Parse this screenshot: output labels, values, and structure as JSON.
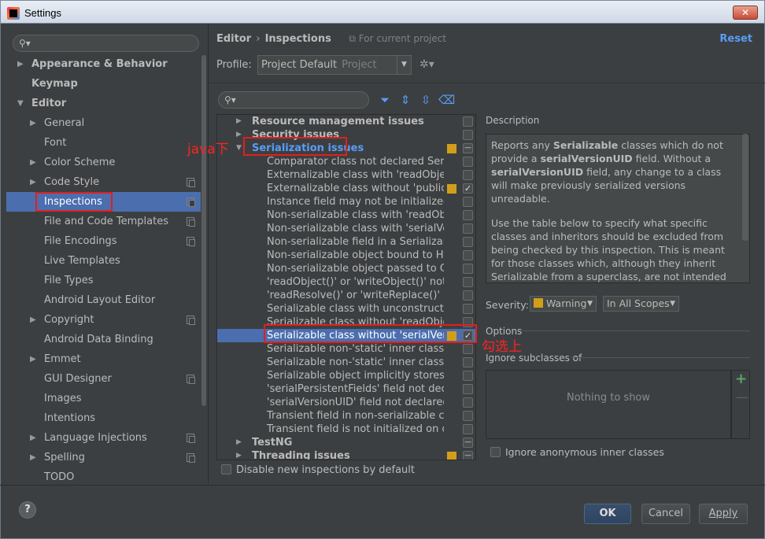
{
  "window": {
    "title": "Settings",
    "close_label": "✕"
  },
  "sidebar": {
    "search_placeholder": "",
    "items": [
      {
        "label": "Appearance & Behavior",
        "level": 0,
        "arrow": "▶",
        "bold": true
      },
      {
        "label": "Keymap",
        "level": 0,
        "arrow": "",
        "bold": true
      },
      {
        "label": "Editor",
        "level": 0,
        "arrow": "▼",
        "bold": true
      },
      {
        "label": "General",
        "level": 1,
        "arrow": "▶"
      },
      {
        "label": "Font",
        "level": 1,
        "arrow": ""
      },
      {
        "label": "Color Scheme",
        "level": 1,
        "arrow": "▶"
      },
      {
        "label": "Code Style",
        "level": 1,
        "arrow": "▶",
        "copy": true
      },
      {
        "label": "Inspections",
        "level": 1,
        "arrow": "",
        "copy": true,
        "selected": true
      },
      {
        "label": "File and Code Templates",
        "level": 1,
        "arrow": "",
        "copy": true
      },
      {
        "label": "File Encodings",
        "level": 1,
        "arrow": "",
        "copy": true
      },
      {
        "label": "Live Templates",
        "level": 1,
        "arrow": ""
      },
      {
        "label": "File Types",
        "level": 1,
        "arrow": ""
      },
      {
        "label": "Android Layout Editor",
        "level": 1,
        "arrow": ""
      },
      {
        "label": "Copyright",
        "level": 1,
        "arrow": "▶",
        "copy": true
      },
      {
        "label": "Android Data Binding",
        "level": 1,
        "arrow": ""
      },
      {
        "label": "Emmet",
        "level": 1,
        "arrow": "▶"
      },
      {
        "label": "GUI Designer",
        "level": 1,
        "arrow": "",
        "copy": true
      },
      {
        "label": "Images",
        "level": 1,
        "arrow": ""
      },
      {
        "label": "Intentions",
        "level": 1,
        "arrow": ""
      },
      {
        "label": "Language Injections",
        "level": 1,
        "arrow": "▶",
        "copy": true
      },
      {
        "label": "Spelling",
        "level": 1,
        "arrow": "▶",
        "copy": true
      },
      {
        "label": "TODO",
        "level": 1,
        "arrow": ""
      }
    ]
  },
  "header": {
    "crumb_editor": "Editor",
    "crumb_sep": "›",
    "crumb_inspections": "Inspections",
    "scope_note": "For current project",
    "reset": "Reset"
  },
  "profile": {
    "label": "Profile:",
    "value": "Project Default",
    "sub": "Project"
  },
  "inspections": [
    {
      "label": "Resource management issues",
      "type": "group",
      "arrow": "▶",
      "cb": "empty"
    },
    {
      "label": "Security issues",
      "type": "group",
      "arrow": "▶",
      "cb": "empty"
    },
    {
      "label": "Serialization issues",
      "type": "group",
      "arrow": "▼",
      "cb": "dash",
      "sev": true,
      "link": true
    },
    {
      "label": "Comparator class not declared Serializable",
      "type": "child",
      "cb": "empty"
    },
    {
      "label": "Externalizable class with 'readObject()' or 'writeObject()'",
      "type": "child",
      "cb": "empty"
    },
    {
      "label": "Externalizable class without 'public' no-arg constructor",
      "type": "child",
      "cb": "checked",
      "sev": true
    },
    {
      "label": "Instance field may not be initialized by readObject()",
      "type": "child",
      "cb": "empty"
    },
    {
      "label": "Non-serializable class with 'readObject()' or 'writeObject()'",
      "type": "child",
      "cb": "empty"
    },
    {
      "label": "Non-serializable class with 'serialVersionUID'",
      "type": "child",
      "cb": "empty"
    },
    {
      "label": "Non-serializable field in a Serializable class",
      "type": "child",
      "cb": "empty"
    },
    {
      "label": "Non-serializable object bound to HttpSession",
      "type": "child",
      "cb": "empty"
    },
    {
      "label": "Non-serializable object passed to ObjectOutputStream",
      "type": "child",
      "cb": "empty"
    },
    {
      "label": "'readObject()' or 'writeObject()' not declared 'private'",
      "type": "child",
      "cb": "empty"
    },
    {
      "label": "'readResolve()' or 'writeReplace()' not declared 'protected'",
      "type": "child",
      "cb": "empty"
    },
    {
      "label": "Serializable class with unconstructable ancestor",
      "type": "child",
      "cb": "empty"
    },
    {
      "label": "Serializable class without 'readObject()' and 'writeObject()'",
      "type": "child",
      "cb": "empty"
    },
    {
      "label": "Serializable class without 'serialVersionUID'",
      "type": "child",
      "cb": "checked",
      "sev": true,
      "selected": true
    },
    {
      "label": "Serializable non-'static' inner class with non-Serializable outer class",
      "type": "child",
      "cb": "empty"
    },
    {
      "label": "Serializable non-'static' inner class without 'serialVersionUID'",
      "type": "child",
      "cb": "empty"
    },
    {
      "label": "Serializable object implicitly stores non-Serializable object",
      "type": "child",
      "cb": "empty"
    },
    {
      "label": "'serialPersistentFields' field not declared 'private static final'",
      "type": "child",
      "cb": "empty"
    },
    {
      "label": "'serialVersionUID' field not declared 'private static final long'",
      "type": "child",
      "cb": "empty"
    },
    {
      "label": "Transient field in non-serializable class",
      "type": "child",
      "cb": "empty"
    },
    {
      "label": "Transient field is not initialized on deserialization",
      "type": "child",
      "cb": "empty"
    },
    {
      "label": "TestNG",
      "type": "group",
      "arrow": "▶",
      "cb": "dash"
    },
    {
      "label": "Threading issues",
      "type": "group",
      "arrow": "▶",
      "cb": "dash",
      "sev": true
    }
  ],
  "annotations": {
    "java_label": "java下",
    "check_label": "勾选上"
  },
  "disable_new": "Disable new inspections by default",
  "description": {
    "title": "Description",
    "p1_a": "Reports any ",
    "p1_b": "Serializable",
    "p1_c": " classes which do not provide a ",
    "p1_d": "serialVersionUID",
    "p1_e": " field. Without a ",
    "p1_f": "serialVersionUID",
    "p1_g": " field, any change to a class will make previously serialized versions unreadable.",
    "p2": "Use the table below to specify what specific classes and inheritors should be excluded from being checked by this inspection. This is meant for those classes which, although they inherit Serializable from a superclass, are not intended for serialization. Such classes would lead this inspection to report"
  },
  "severity": {
    "label": "Severity:",
    "value": "Warning",
    "scope": "In All Scopes"
  },
  "options": {
    "title": "Options",
    "ignore_subclasses": "Ignore subclasses of",
    "empty_list": "Nothing to show",
    "ignore_anonymous": "Ignore anonymous inner classes"
  },
  "footer": {
    "help": "?",
    "ok": "OK",
    "cancel": "Cancel",
    "apply": "Apply"
  },
  "colors": {
    "accent": "#4b6eaf",
    "warning": "#d29d1a",
    "annotation": "#e0201c",
    "link": "#589df6"
  }
}
